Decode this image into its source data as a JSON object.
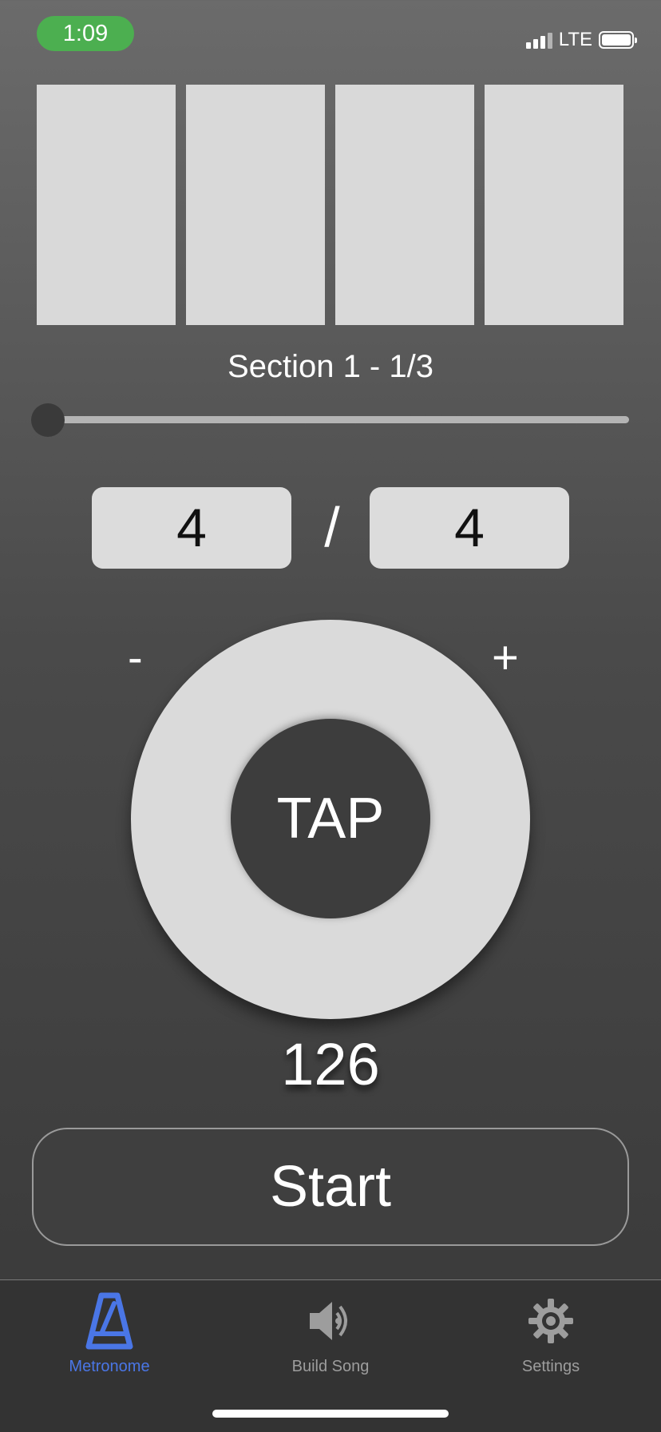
{
  "status_bar": {
    "time": "1:09",
    "network": "LTE"
  },
  "section_label": "Section 1 - 1/3",
  "progress": {
    "position_fraction": 0.0
  },
  "time_signature": {
    "beats": "4",
    "separator": "/",
    "note_value": "4"
  },
  "tempo": {
    "minus_label": "-",
    "plus_label": "+",
    "tap_label": "TAP",
    "bpm": "126"
  },
  "start_button": {
    "label": "Start"
  },
  "tabs": [
    {
      "label": "Metronome",
      "icon": "metronome-icon",
      "active": true
    },
    {
      "label": "Build Song",
      "icon": "speaker-icon",
      "active": false
    },
    {
      "label": "Settings",
      "icon": "gear-icon",
      "active": false
    }
  ],
  "colors": {
    "accent": "#4a76e6",
    "time_pill": "#4caf50",
    "panel": "#d9d9d9"
  }
}
